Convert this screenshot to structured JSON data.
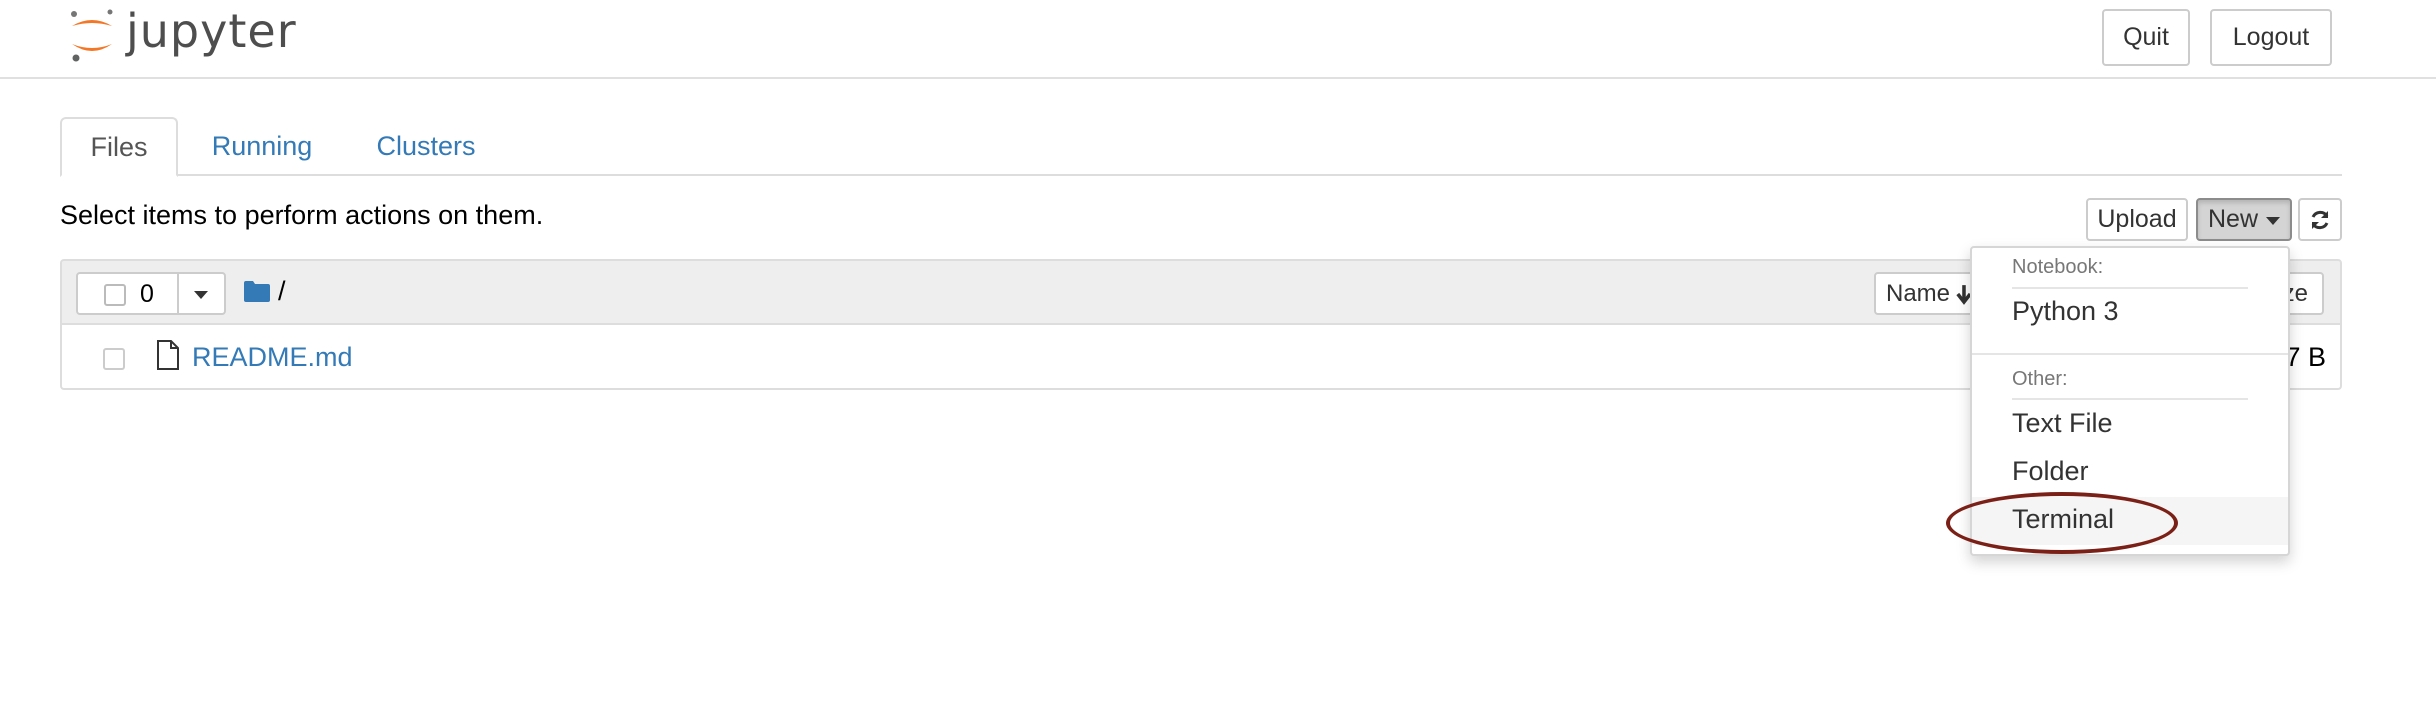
{
  "header": {
    "logo_text": "jupyter",
    "quit_label": "Quit",
    "logout_label": "Logout"
  },
  "tabs": [
    {
      "label": "Files",
      "active": true
    },
    {
      "label": "Running",
      "active": false
    },
    {
      "label": "Clusters",
      "active": false
    }
  ],
  "toolbar": {
    "instructions": "Select items to perform actions on them.",
    "upload_label": "Upload",
    "new_label": "New",
    "refresh_icon": "refresh-icon"
  },
  "list_header": {
    "selected_count": "0",
    "path": "/",
    "sort_name_label": "Name",
    "sort_icon": "arrow-down-icon",
    "size_label": "Last Modified File size"
  },
  "files": [
    {
      "name": "README.md",
      "size": "7 B",
      "icon": "file-icon"
    }
  ],
  "new_menu": {
    "notebook_header": "Notebook:",
    "notebook_items": [
      "Python 3"
    ],
    "other_header": "Other:",
    "other_items": [
      "Text File",
      "Folder",
      "Terminal"
    ],
    "highlighted": "Terminal"
  },
  "colors": {
    "link": "#337ab7",
    "logo_orange": "#f37726",
    "annotation": "#7b2016"
  }
}
